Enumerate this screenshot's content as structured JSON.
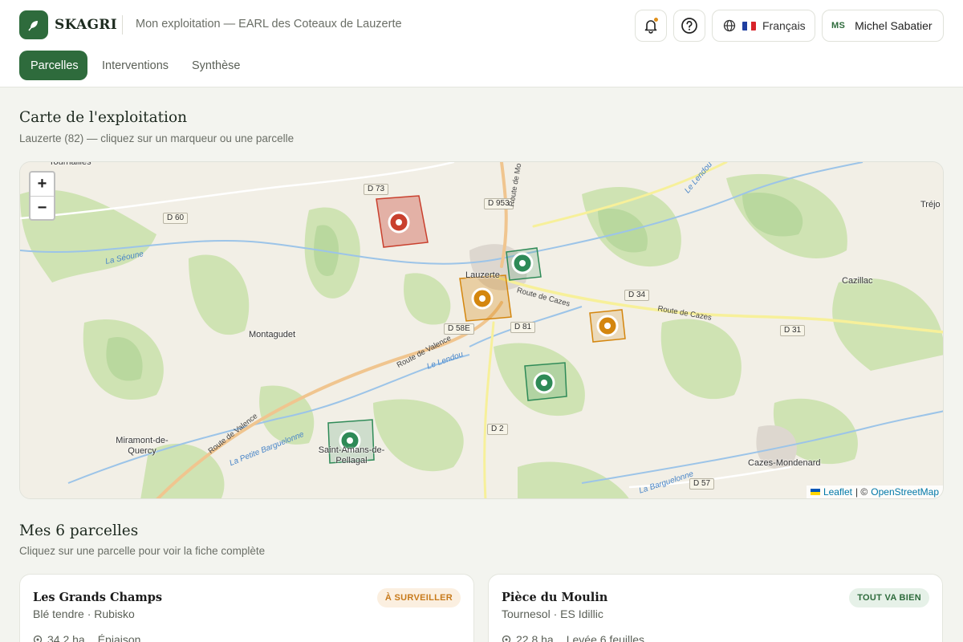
{
  "app": {
    "brand": "SKAGRI",
    "farm_title": "Mon exploitation — EARL des Coteaux de Lauzerte",
    "language": "Français",
    "user_initials": "MS",
    "user_name": "Michel Sabatier",
    "accent_color": "#2e6b3c"
  },
  "tabs": [
    {
      "label": "Parcelles",
      "active": true
    },
    {
      "label": "Interventions",
      "active": false
    },
    {
      "label": "Synthèse",
      "active": false
    }
  ],
  "map_section": {
    "title": "Carte de l'exploitation",
    "subtitle": "Lauzerte (82) — cliquez sur un marqueur ou une parcelle",
    "zoom_in": "+",
    "zoom_out": "−",
    "attribution_leaflet": "Leaflet",
    "attribution_sep": "| ©",
    "attribution_osm": "OpenStreetMap",
    "places": [
      "Lauzerte",
      "Montagudet",
      "Cazillac",
      "Tréjo",
      "Miramont-de-Quercy",
      "Saint-Amans-de-Pellagal",
      "Cazes-Mondenard",
      "Tournailles"
    ],
    "roads": [
      "D 73",
      "D 60",
      "D 953",
      "D 34",
      "D 58E",
      "D 81",
      "D 31",
      "D 2",
      "D 57"
    ],
    "rivers": [
      "La Séoune",
      "Le Lendou",
      "La Petite Barguelonne",
      "La Barguelonne",
      "Le Lendou"
    ],
    "road_names": [
      "Route de Valence",
      "Route de Cazes",
      "Route de Cazes",
      "Route de Valence",
      "Route de Mo"
    ],
    "status_colors": {
      "alert": "#c9402e",
      "warn": "#d4860e",
      "ok": "#2e8a57"
    }
  },
  "parcels_section": {
    "title": "Mes 6 parcelles",
    "subtitle": "Cliquez sur une parcelle pour voir la fiche complète"
  },
  "parcels": [
    {
      "name": "Les Grands Champs",
      "crop": "Blé tendre · Rubisko",
      "area": "34,2 ha",
      "stage": "Épiaison",
      "status": "À SURVEILLER"
    },
    {
      "name": "Pièce du Moulin",
      "crop": "Tournesol · ES Idillic",
      "area": "22,8 ha",
      "stage": "Levée 6 feuilles",
      "status": "TOUT VA BIEN"
    }
  ]
}
